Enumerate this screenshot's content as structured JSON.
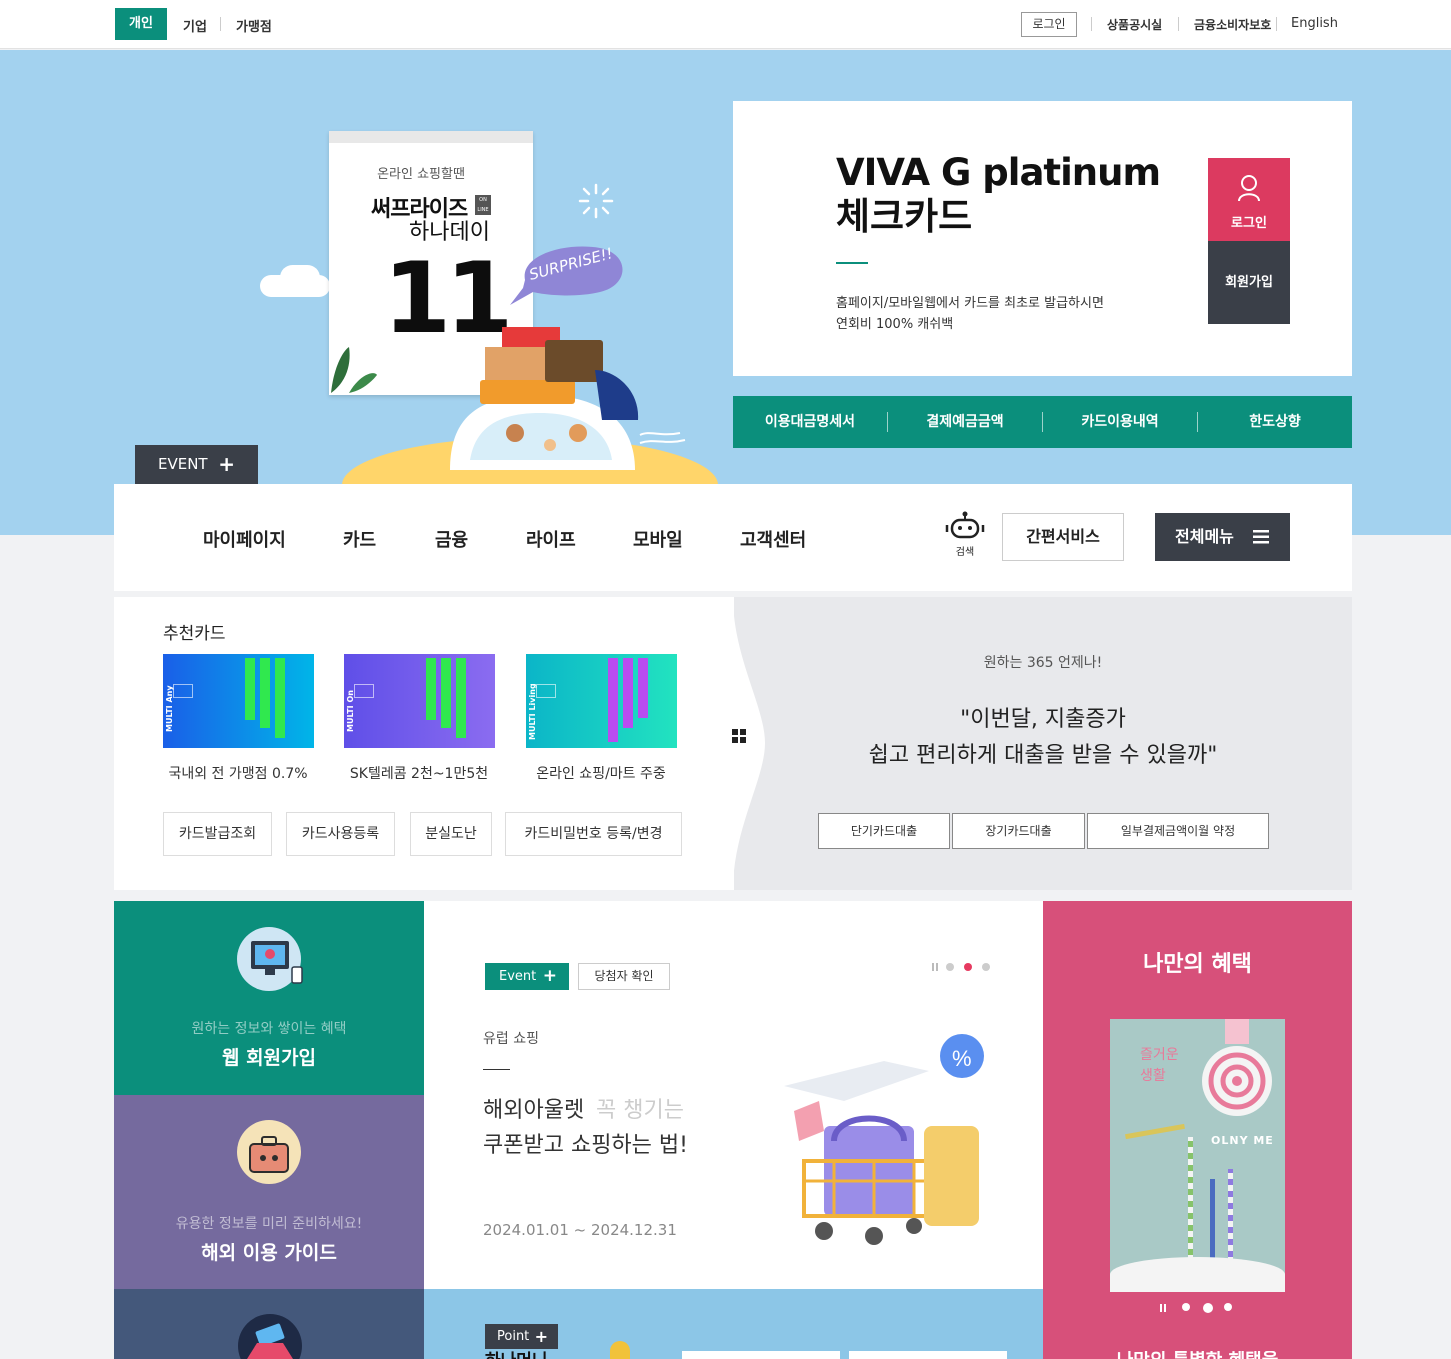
{
  "util": {
    "tabs": [
      "개인",
      "기업",
      "가맹점"
    ],
    "login": "로그인",
    "links": [
      "상품공시실",
      "금융소비자보호",
      "English"
    ]
  },
  "hero": {
    "calendar": {
      "line1": "온라인 쇼핑할땐",
      "brand": "써프라이즈",
      "brand2": "하나데이",
      "badge": "ON LINE",
      "number": "11",
      "bubble": "SURPRISE!!"
    },
    "event_label": "EVENT",
    "promo": {
      "title_line1": "VIVA G platinum",
      "title_line2": "체크카드",
      "desc_line1": "홈페이지/모바일웹에서 카드를 최초로 발급하시면",
      "desc_line2": "연회비 100% 캐쉬백",
      "login": "로그인",
      "join": "회원가입"
    },
    "quick": [
      "이용대금명세서",
      "결제예금금액",
      "카드이용내역",
      "한도상향"
    ]
  },
  "gnb": {
    "items": [
      "마이페이지",
      "카드",
      "금융",
      "라이프",
      "모바일",
      "고객센터"
    ],
    "search": "검색",
    "simple": "간편서비스",
    "all_menu": "전체메뉴"
  },
  "rec": {
    "title": "추천카드",
    "cards": [
      {
        "label": "국내외 전 가맹점 0.7%",
        "name": "MULTI Any",
        "c1": "#1a5fe8",
        "c2": "#00b5e8"
      },
      {
        "label": "SK텔레콤 2천~1만5천",
        "name": "MULTI On",
        "c1": "#5f4fe8",
        "c2": "#8b6cf0"
      },
      {
        "label": "온라인 쇼핑/마트 주중",
        "name": "MULTI Living",
        "c1": "#0bb5c8",
        "c2": "#22e3c0"
      }
    ],
    "buttons": [
      "카드발급조회",
      "카드사용등록",
      "분실도난",
      "카드비밀번호 등록/변경"
    ]
  },
  "loan": {
    "sub": "원하는 365 언제나!",
    "quote_line1": "\"이번달, 지출증가",
    "quote_line2": "쉽고 편리하게 대출을 받을 수 있을까\"",
    "buttons": [
      "단기카드대출",
      "장기카드대출",
      "일부결제금액이월 약정"
    ]
  },
  "side": [
    {
      "sub": "원하는 정보와 쌓이는 혜택",
      "title": "웹 회원가입"
    },
    {
      "sub": "유용한 정보를 미리 준비하세요!",
      "title": "해외 이용 가이드"
    }
  ],
  "event": {
    "tag": "Event",
    "winner": "당첨자 확인",
    "category": "유럽 쇼핑",
    "title_line1": "해외아울렛",
    "title_ghost": "꼭 챙기는",
    "title_line2": "쿠폰받고 쇼핑하는 법!",
    "date": "2024.01.01 ~ 2024.12.31"
  },
  "point": {
    "tag": "Point",
    "title": "하나머니"
  },
  "benefit": {
    "title": "나만의 혜택",
    "img_text1": "즐거운",
    "img_text2": "생활",
    "img_text3": "OLNY ME",
    "bottom": "나만의 특별한 혜택을"
  },
  "colors": {
    "accent": "#0b8f7c",
    "hero_bg": "#a3d2ef",
    "pink": "#d7507a",
    "purple": "#756a9e",
    "navy": "#44587b",
    "login_red": "#dc3a60",
    "dark": "#3a3f48"
  }
}
